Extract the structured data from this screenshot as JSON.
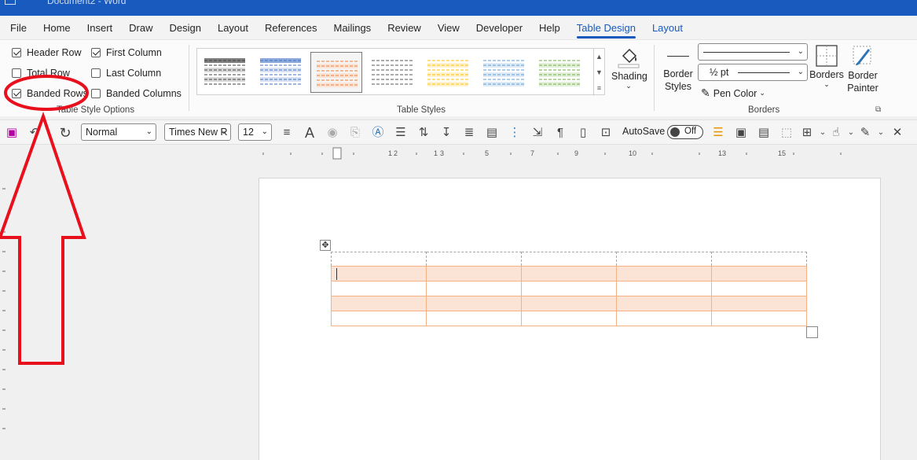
{
  "titlebar": {
    "text": "Document2 - Word"
  },
  "menu": {
    "tabs": [
      "File",
      "Home",
      "Insert",
      "Draw",
      "Design",
      "Layout",
      "References",
      "Mailings",
      "Review",
      "View",
      "Developer",
      "Help",
      "Table Design",
      "Layout"
    ],
    "active": "Table Design"
  },
  "table_style_options": {
    "label": "Table Style Options",
    "items": [
      {
        "label": "Header Row",
        "checked": true
      },
      {
        "label": "First Column",
        "checked": true
      },
      {
        "label": "Total Row",
        "checked": false
      },
      {
        "label": "Last Column",
        "checked": false
      },
      {
        "label": "Banded Rows",
        "checked": true
      },
      {
        "label": "Banded Columns",
        "checked": false
      }
    ]
  },
  "table_styles": {
    "label": "Table Styles",
    "shading_label": "Shading"
  },
  "borders": {
    "label": "Borders",
    "border_styles_label": "Border\nStyles",
    "line_weight": "½ pt",
    "pen_color_label": "Pen Color",
    "borders_label": "Borders",
    "border_painter_label": "Border\nPainter"
  },
  "qat": {
    "style": "Normal",
    "font": "Times New R",
    "size": "12",
    "autosave_label": "AutoSave",
    "autosave_state": "Off"
  },
  "colors": {
    "accent": "#185abd",
    "band_fill": "#fbe4d5",
    "band_border": "#f4b183",
    "annotation": "#e8101d"
  }
}
